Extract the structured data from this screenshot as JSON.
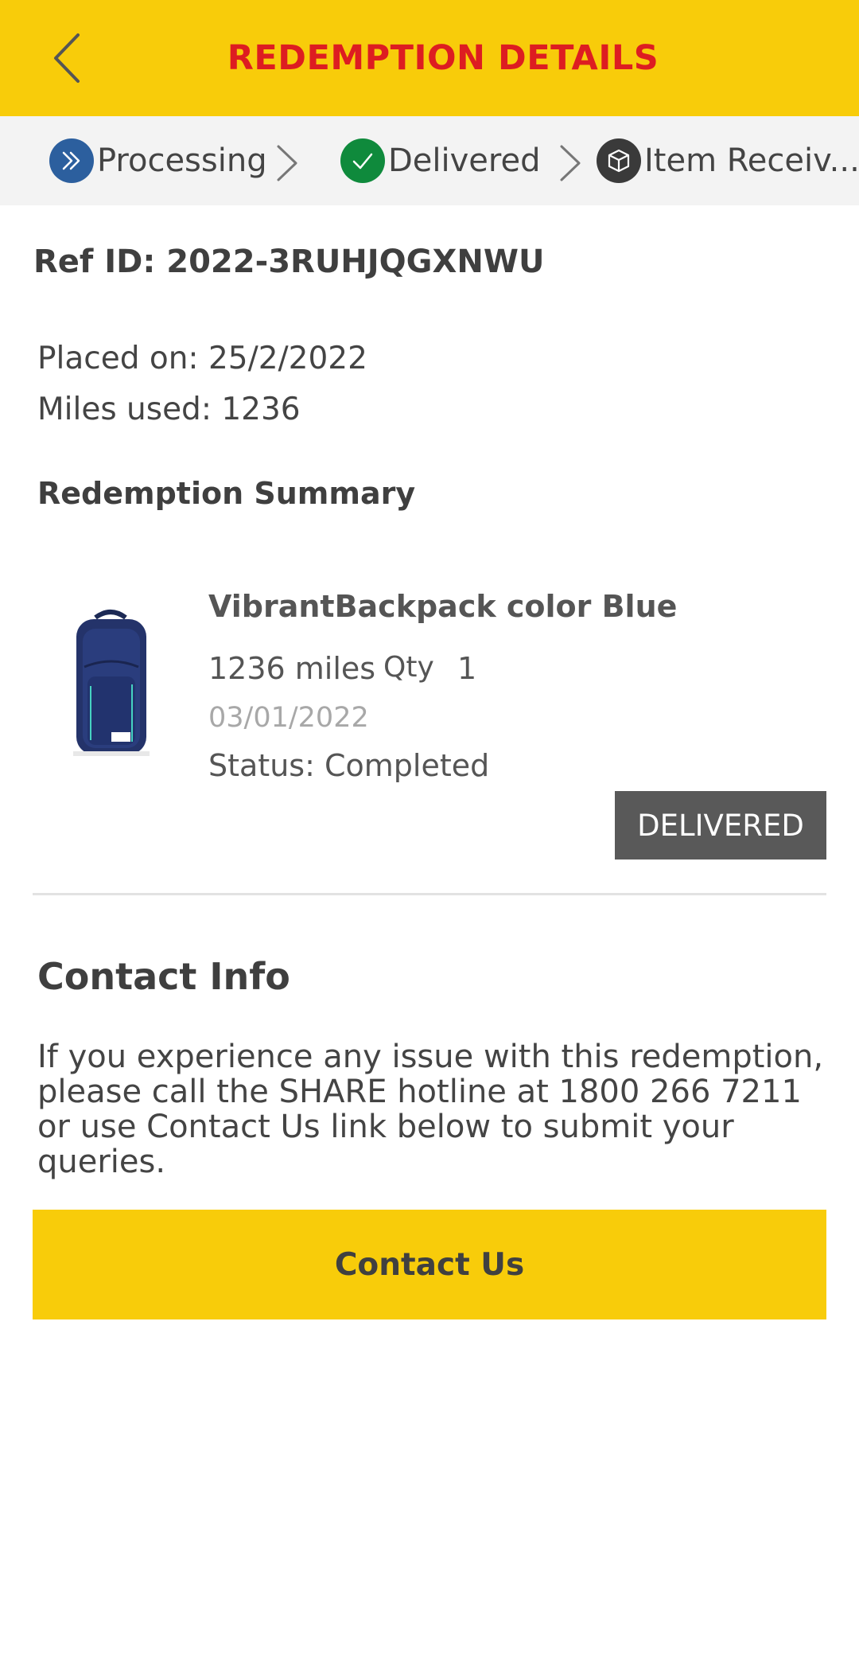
{
  "header": {
    "title": "REDEMPTION DETAILS"
  },
  "steps": [
    {
      "label": "Processing"
    },
    {
      "label": "Delivered"
    },
    {
      "label": "Item Receiv..."
    }
  ],
  "order": {
    "ref_id": "Ref ID: 2022-3RUHJQGXNWU",
    "placed_on": "Placed on: 25/2/2022",
    "miles_used": "Miles used: 1236"
  },
  "summary": {
    "title": "Redemption Summary",
    "item": {
      "name": "VibrantBackpack color Blue",
      "miles": "1236 miles",
      "qty_label": "Qty",
      "qty_value": "1",
      "date": "03/01/2022",
      "status": "Status: Completed",
      "badge": "DELIVERED"
    }
  },
  "contact": {
    "title": "Contact Info",
    "text": "If you experience any issue with this redemption, please call the SHARE hotline at 1800 266 7211 or use Contact Us link below to submit your queries.",
    "button": "Contact Us"
  },
  "colors": {
    "brand_yellow": "#F8CC0A",
    "brand_red": "#DD1D21",
    "processing_blue": "#2C5F9E",
    "delivered_green": "#0F8A3C",
    "received_dark": "#3A3A3A",
    "badge_gray": "#595959"
  }
}
